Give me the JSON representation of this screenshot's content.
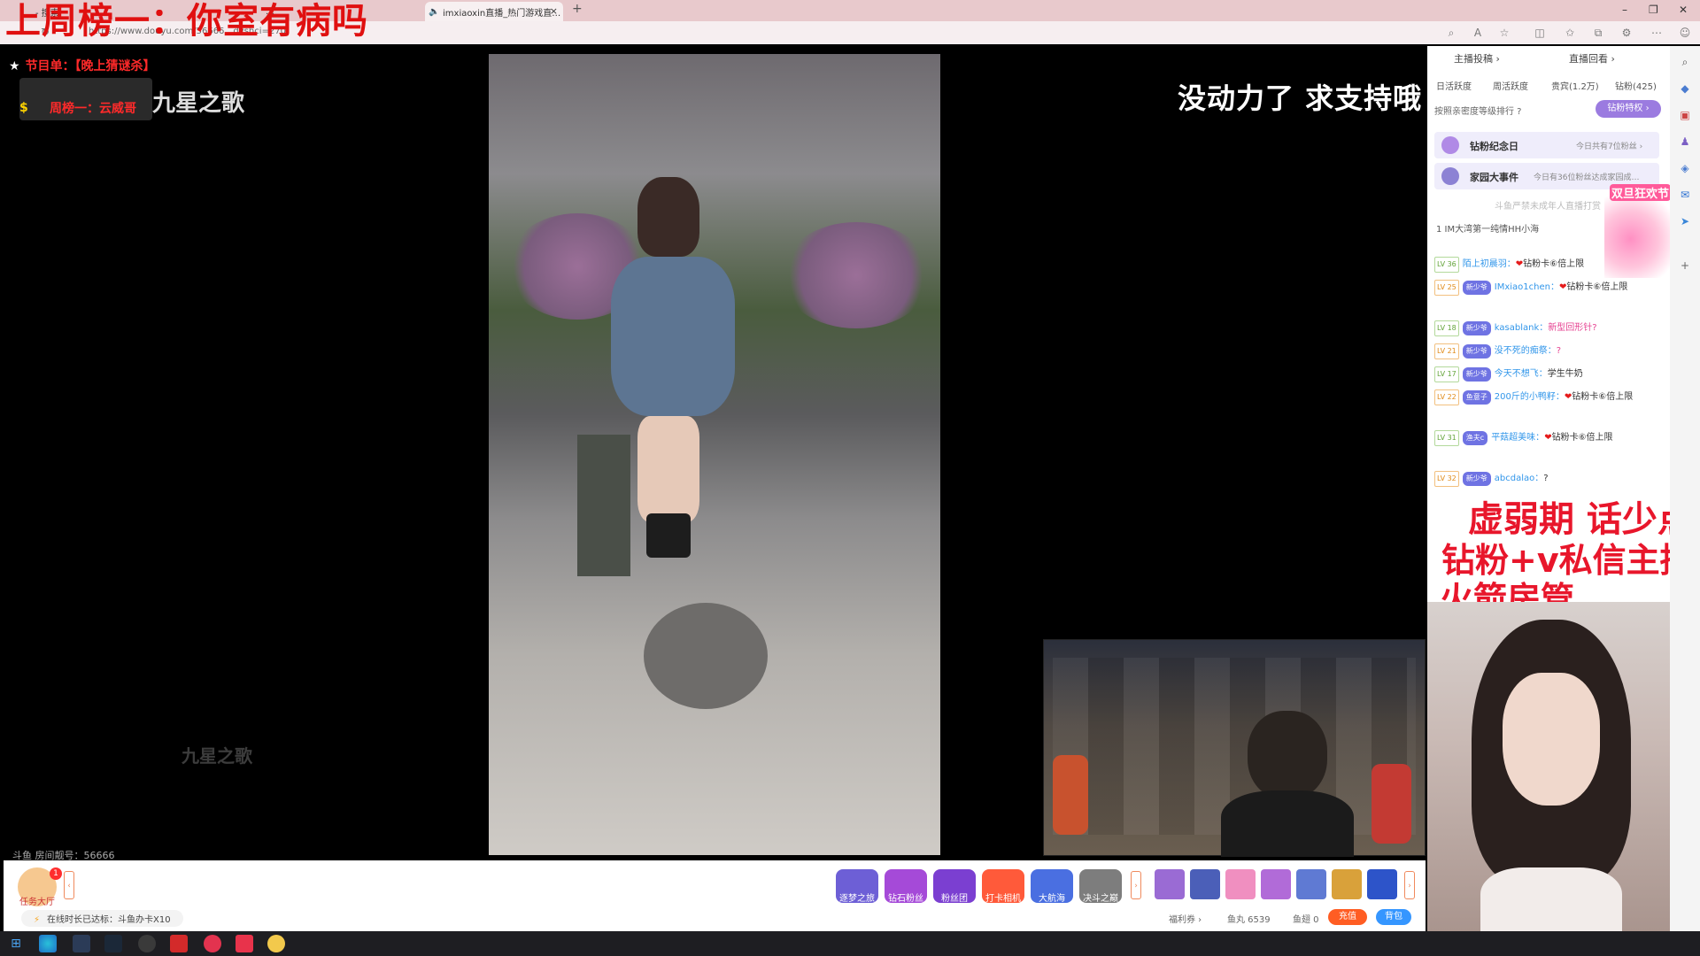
{
  "browser": {
    "tabs": [
      {
        "label": "- 搜索",
        "active": false
      },
      {
        "label": "…",
        "active": false
      },
      {
        "label": "imxiaoxin直播_热门游戏直…",
        "active": true
      }
    ],
    "new_tab": "+",
    "url": "https://www.douyu.com/56666…dyshci=270",
    "window_controls": {
      "minimize": "–",
      "restore": "❐",
      "close": "✕"
    }
  },
  "overlays": {
    "top_banner": "上周榜一：你室有病吗",
    "program_label": "节目单：【晚上猜谜杀】",
    "week_rank": "周榜一：云威哥",
    "anchor_name": "九星之歌",
    "top_right_caption": "没动力了 求支持哦",
    "watermark": "九星之歌",
    "room_number": "斗鱼 房间靓号：56666"
  },
  "bottom_bar": {
    "task_hall": "任务大厅",
    "task_badge": "1",
    "activities": [
      {
        "label": "逐梦之旅",
        "color": "#6d5fd6"
      },
      {
        "label": "钻石粉丝",
        "color": "#a54ad8"
      },
      {
        "label": "粉丝团",
        "color": "#7b3fd1"
      },
      {
        "label": "打卡相机",
        "color": "#ff5a3a"
      },
      {
        "label": "大航海",
        "color": "#4a6fe1"
      },
      {
        "label": "决斗之巅",
        "color": "#7d7d7d"
      }
    ],
    "online_tip": "在线时长已达标：斗鱼办卡X10",
    "fuli": "福利券 ›",
    "yuwan": "鱼丸 6539",
    "yuchi": "鱼翅 0",
    "recharge": "充值",
    "backpack": "背包",
    "gift_colors": [
      "#9a6bd4",
      "#4b5fb8",
      "#f08fc0",
      "#b16bd8",
      "#5f7ad3",
      "#d9a13a",
      "#2d54c9"
    ]
  },
  "panel": {
    "tabs": {
      "contribute": "主播投稿 ›",
      "replay": "直播回看 ›"
    },
    "stats": [
      "日活跃度",
      "周活跃度",
      "贵宾(1.2万)",
      "钻粉(425)"
    ],
    "rank_title": "按照亲密度等级排行 ?",
    "diamond_btn": "钻粉特权 ›",
    "card1": {
      "title": "钻粉纪念日",
      "sub": "今日共有7位粉丝 ›"
    },
    "card2": {
      "title": "家园大事件",
      "sub": "今日有36位粉丝达成家园成…"
    },
    "minor_note": "斗鱼严禁未成年人直播打赏",
    "im_row": "1  IM大湾第一纯情HH小海",
    "festival": "双旦狂欢节",
    "chat": [
      {
        "lv": "LV 36",
        "badge": "",
        "user": "陌上初晨羽：",
        "msg": "钻粉卡⑥倍上限",
        "heart": true,
        "pink": false
      },
      {
        "lv": "LV 25",
        "badge": "新少爷",
        "user": "IMxiao1chen：",
        "msg": "钻粉卡⑥倍上限",
        "heart": true,
        "pink": false
      },
      {
        "lv": "LV 18",
        "badge": "新少爷",
        "user": "kasablank：",
        "msg": "新型回形针?",
        "heart": false,
        "pink": true
      },
      {
        "lv": "LV 21",
        "badge": "新少爷",
        "user": "没不死的痴祭：",
        "msg": "?",
        "heart": false,
        "pink": true
      },
      {
        "lv": "LV 17",
        "badge": "新少爷",
        "user": "今天不想飞：",
        "msg": "学生牛奶",
        "heart": false,
        "pink": false
      },
      {
        "lv": "LV 22",
        "badge": "鱼意子",
        "user": "200斤的小鸭籽：",
        "msg": "钻粉卡⑥倍上限",
        "heart": true,
        "pink": false
      },
      {
        "lv": "LV 31",
        "badge": "渔夫c",
        "user": "平菇超美味：",
        "msg": "钻粉卡⑥倍上限",
        "heart": true,
        "pink": false
      },
      {
        "lv": "LV 32",
        "badge": "新少爷",
        "user": "abcdalao：",
        "msg": "?",
        "heart": false,
        "pink": false
      }
    ],
    "overlay_lines": [
      "虚弱期 话少点",
      "钻粉+v私信主播",
      "火箭房管"
    ]
  }
}
